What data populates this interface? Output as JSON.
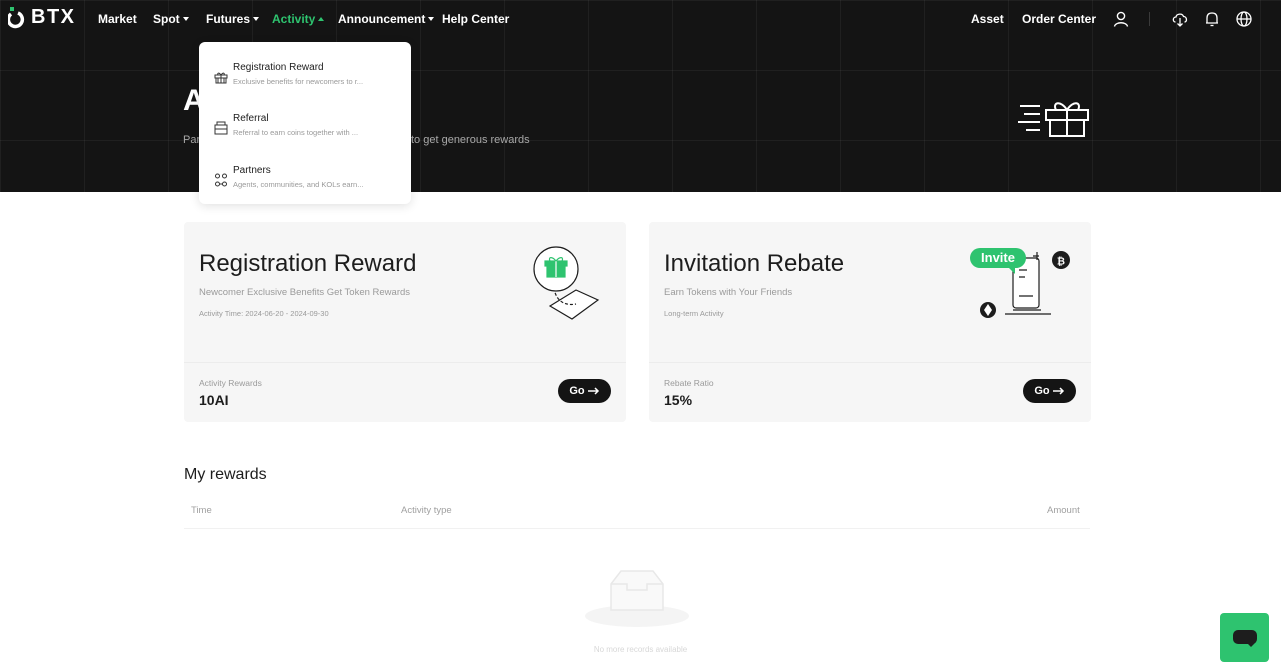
{
  "brand": {
    "name": "BTX"
  },
  "nav": {
    "items": [
      {
        "label": "Market",
        "caret": false
      },
      {
        "label": "Spot",
        "caret": true
      },
      {
        "label": "Futures",
        "caret": true
      },
      {
        "label": "Activity",
        "caret": true,
        "active": true
      },
      {
        "label": "Announcement",
        "caret": true
      },
      {
        "label": "Help Center",
        "caret": false
      }
    ],
    "right": {
      "asset": "Asset",
      "order_center": "Order Center"
    },
    "icons": [
      "user-icon",
      "download-icon",
      "bell-icon",
      "globe-icon"
    ]
  },
  "hero": {
    "title_visible": "A",
    "subtitle_left": "Par",
    "subtitle_right": "to get generous rewards"
  },
  "dropdown": {
    "items": [
      {
        "icon": "gift-box-icon",
        "title": "Registration Reward",
        "desc": "Exclusive benefits for newcomers to r..."
      },
      {
        "icon": "envelope-icon",
        "title": "Referral",
        "desc": "Referral to earn coins together with ..."
      },
      {
        "icon": "partners-icon",
        "title": "Partners",
        "desc": "Agents, communities, and KOLs earn..."
      }
    ]
  },
  "cards": [
    {
      "title": "Registration Reward",
      "subtitle": "Newcomer Exclusive Benefits Get Token Rewards",
      "time": "Activity Time: 2024-06-20 - 2024-09-30",
      "label": "Activity Rewards",
      "value": "10AI",
      "button": "Go"
    },
    {
      "title": "Invitation Rebate",
      "subtitle": "Earn Tokens with Your Friends",
      "time": "Long-term Activity",
      "label": "Rebate Ratio",
      "value": "15%",
      "button": "Go",
      "badge": "Invite"
    }
  ],
  "rewards": {
    "title": "My rewards",
    "columns": [
      "Time",
      "Activity type",
      "Amount"
    ],
    "empty_text": "No more records available"
  },
  "colors": {
    "accent": "#2ec36f",
    "dark": "#141414",
    "card_bg": "#f6f6f6"
  }
}
